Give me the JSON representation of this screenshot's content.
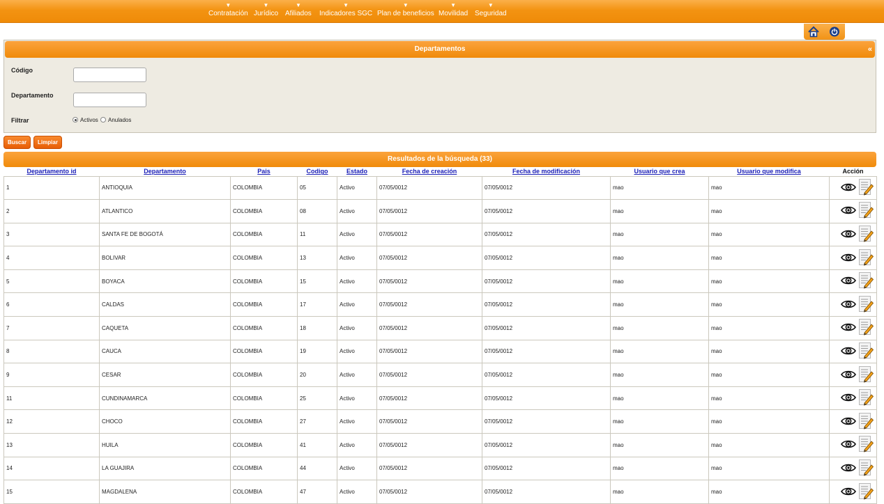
{
  "nav": {
    "items": [
      {
        "label": "Contratación"
      },
      {
        "label": "Jurídico"
      },
      {
        "label": "Afiliados"
      },
      {
        "label": "Indicadores SGC"
      },
      {
        "label": "Plan de beneficios"
      },
      {
        "label": "Movilidad"
      },
      {
        "label": "Seguridad"
      }
    ],
    "arrow": "▼"
  },
  "topicons": {
    "home": "home-icon",
    "power": "power-icon"
  },
  "filter": {
    "title": "Departamentos",
    "collapse_glyph": "«",
    "codigo_label": "Código",
    "codigo_value": "",
    "departamento_label": "Departamento",
    "departamento_value": "",
    "filtrar_label": "Filtrar",
    "activos_label": "Activos",
    "anulados_label": "Anulados",
    "selected": "Activos"
  },
  "buttons": {
    "buscar": "Buscar",
    "limpiar": "Limpiar"
  },
  "results": {
    "title": "Resultados de la búsqueda (33)",
    "columns": [
      "Departamento id",
      "Departamento",
      "Pais",
      "Codigo",
      "Estado",
      "Fecha de creación",
      "Fecha de modificación",
      "Usuario que crea",
      "Usuario que modifica",
      "Acción"
    ],
    "rows": [
      [
        "1",
        "ANTIOQUIA",
        "COLOMBIA",
        "05",
        "Activo",
        "07/05/0012",
        "07/05/0012",
        "mao",
        "mao"
      ],
      [
        "2",
        "ATLANTICO",
        "COLOMBIA",
        "08",
        "Activo",
        "07/05/0012",
        "07/05/0012",
        "mao",
        "mao"
      ],
      [
        "3",
        "SANTA FE DE BOGOTÁ",
        "COLOMBIA",
        "11",
        "Activo",
        "07/05/0012",
        "07/05/0012",
        "mao",
        "mao"
      ],
      [
        "4",
        "BOLIVAR",
        "COLOMBIA",
        "13",
        "Activo",
        "07/05/0012",
        "07/05/0012",
        "mao",
        "mao"
      ],
      [
        "5",
        "BOYACA",
        "COLOMBIA",
        "15",
        "Activo",
        "07/05/0012",
        "07/05/0012",
        "mao",
        "mao"
      ],
      [
        "6",
        "CALDAS",
        "COLOMBIA",
        "17",
        "Activo",
        "07/05/0012",
        "07/05/0012",
        "mao",
        "mao"
      ],
      [
        "7",
        "CAQUETA",
        "COLOMBIA",
        "18",
        "Activo",
        "07/05/0012",
        "07/05/0012",
        "mao",
        "mao"
      ],
      [
        "8",
        "CAUCA",
        "COLOMBIA",
        "19",
        "Activo",
        "07/05/0012",
        "07/05/0012",
        "mao",
        "mao"
      ],
      [
        "9",
        "CESAR",
        "COLOMBIA",
        "20",
        "Activo",
        "07/05/0012",
        "07/05/0012",
        "mao",
        "mao"
      ],
      [
        "11",
        "CUNDINAMARCA",
        "COLOMBIA",
        "25",
        "Activo",
        "07/05/0012",
        "07/05/0012",
        "mao",
        "mao"
      ],
      [
        "12",
        "CHOCO",
        "COLOMBIA",
        "27",
        "Activo",
        "07/05/0012",
        "07/05/0012",
        "mao",
        "mao"
      ],
      [
        "13",
        "HUILA",
        "COLOMBIA",
        "41",
        "Activo",
        "07/05/0012",
        "07/05/0012",
        "mao",
        "mao"
      ],
      [
        "14",
        "LA GUAJIRA",
        "COLOMBIA",
        "44",
        "Activo",
        "07/05/0012",
        "07/05/0012",
        "mao",
        "mao"
      ],
      [
        "15",
        "MAGDALENA",
        "COLOMBIA",
        "47",
        "Activo",
        "07/05/0012",
        "07/05/0012",
        "mao",
        "mao"
      ]
    ],
    "action_icons": [
      "eye-icon",
      "edit-icon"
    ]
  },
  "colors": {
    "accent": "#f39312",
    "button": "#e85d06",
    "panel_bg": "#eeebe2",
    "link": "#1e22b8"
  }
}
